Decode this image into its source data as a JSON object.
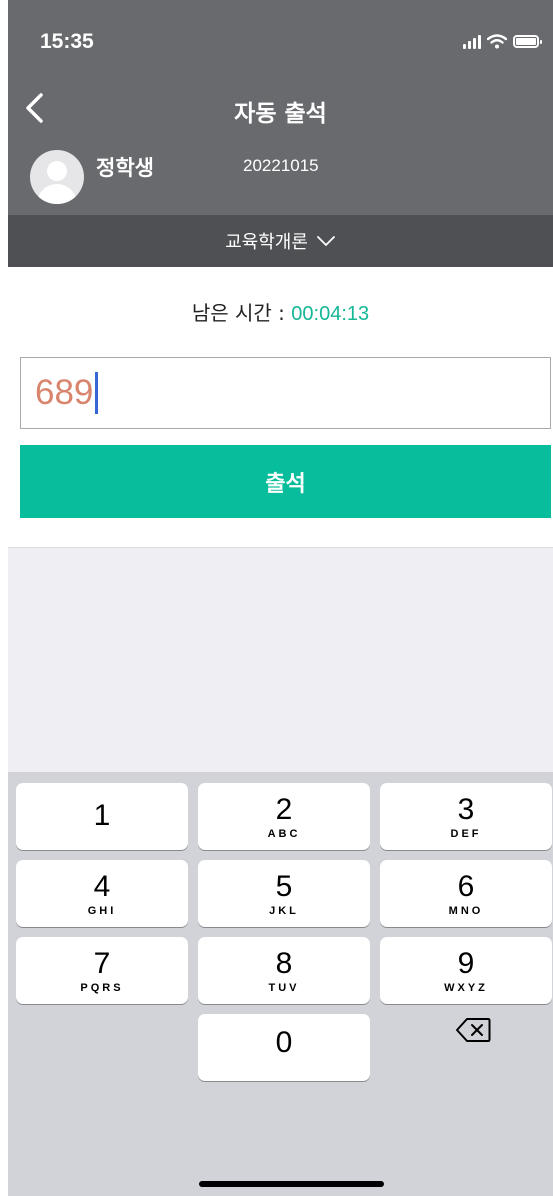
{
  "status_bar": {
    "time": "15:35",
    "icons": [
      "signal-icon",
      "wifi-icon",
      "battery-icon"
    ]
  },
  "nav": {
    "title": "자동 출석",
    "back_icon": "chevron-left-icon"
  },
  "student": {
    "name": "정학생",
    "id": "20221015"
  },
  "course": {
    "name": "교육학개론",
    "dropdown_icon": "chevron-down-icon"
  },
  "timer": {
    "label": "남은 시간 : ",
    "value": "00:04:13"
  },
  "code_input": {
    "value": "689"
  },
  "submit_label": "출석",
  "keypad": {
    "keys": [
      {
        "digit": "1",
        "letters": ""
      },
      {
        "digit": "2",
        "letters": "ABC"
      },
      {
        "digit": "3",
        "letters": "DEF"
      },
      {
        "digit": "4",
        "letters": "GHI"
      },
      {
        "digit": "5",
        "letters": "JKL"
      },
      {
        "digit": "6",
        "letters": "MNO"
      },
      {
        "digit": "7",
        "letters": "PQRS"
      },
      {
        "digit": "8",
        "letters": "TUV"
      },
      {
        "digit": "9",
        "letters": "WXYZ"
      },
      {
        "digit": "0",
        "letters": ""
      }
    ],
    "backspace_icon": "backspace-icon"
  },
  "colors": {
    "header": "#696a6e",
    "course_bar": "#4f5053",
    "accent": "#08bd9b",
    "timer": "#14b796",
    "code": "#d9846d",
    "caret": "#3666d6"
  }
}
